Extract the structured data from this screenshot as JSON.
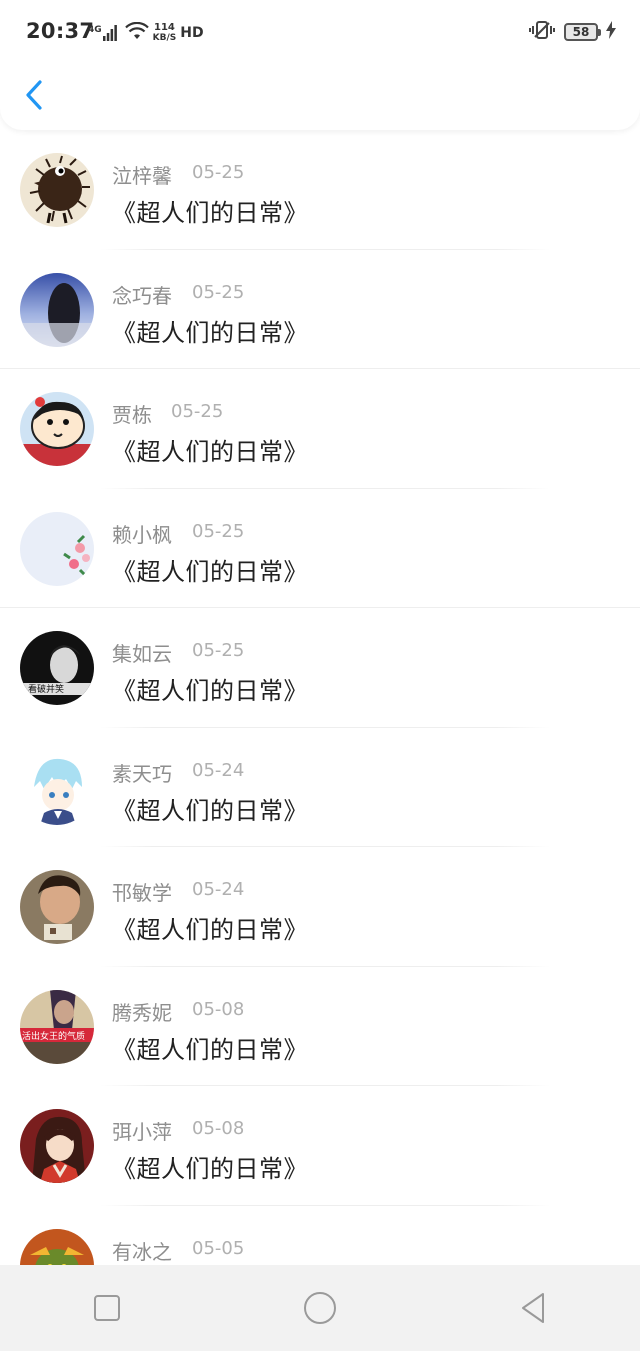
{
  "status_bar": {
    "time": "20:37",
    "network_type": "4G",
    "speed_value": "114",
    "speed_unit": "KB/S",
    "hd": "HD",
    "battery": "58"
  },
  "nav": {
    "back_icon": "chevron-left-icon",
    "accent_color": "#2196f3"
  },
  "list": [
    {
      "name": "泣梓馨",
      "date": "05-25",
      "title": "《超人们的日常》",
      "avatar": "hedgehog"
    },
    {
      "name": "念巧春",
      "date": "05-25",
      "title": "《超人们的日常》",
      "avatar": "blue-sky-girl"
    },
    {
      "name": "贾栋",
      "date": "05-25",
      "title": "《超人们的日常》",
      "avatar": "cartoon-boy"
    },
    {
      "name": "赖小枫",
      "date": "05-25",
      "title": "《超人们的日常》",
      "avatar": "pale-flowers"
    },
    {
      "name": "集如云",
      "date": "05-25",
      "title": "《超人们的日常》",
      "avatar": "bw-portrait"
    },
    {
      "name": "素天巧",
      "date": "05-24",
      "title": "《超人们的日常》",
      "avatar": "anime-blue-hair"
    },
    {
      "name": "邗敏学",
      "date": "05-24",
      "title": "《超人们的日常》",
      "avatar": "selfie-man"
    },
    {
      "name": "腾秀妮",
      "date": "05-08",
      "title": "《超人们的日常》",
      "avatar": "queen-banner"
    },
    {
      "name": "弭小萍",
      "date": "05-08",
      "title": "《超人们的日常》",
      "avatar": "anime-red-robe"
    },
    {
      "name": "有冰之",
      "date": "05-05",
      "title": "",
      "avatar": "orc-warrior"
    }
  ],
  "avatar_texts": {
    "bw_caption": "看破并笑",
    "queen_caption": "活出女王的气质"
  },
  "system_nav": {
    "recent": "square-icon",
    "home": "circle-icon",
    "back": "triangle-back-icon"
  }
}
